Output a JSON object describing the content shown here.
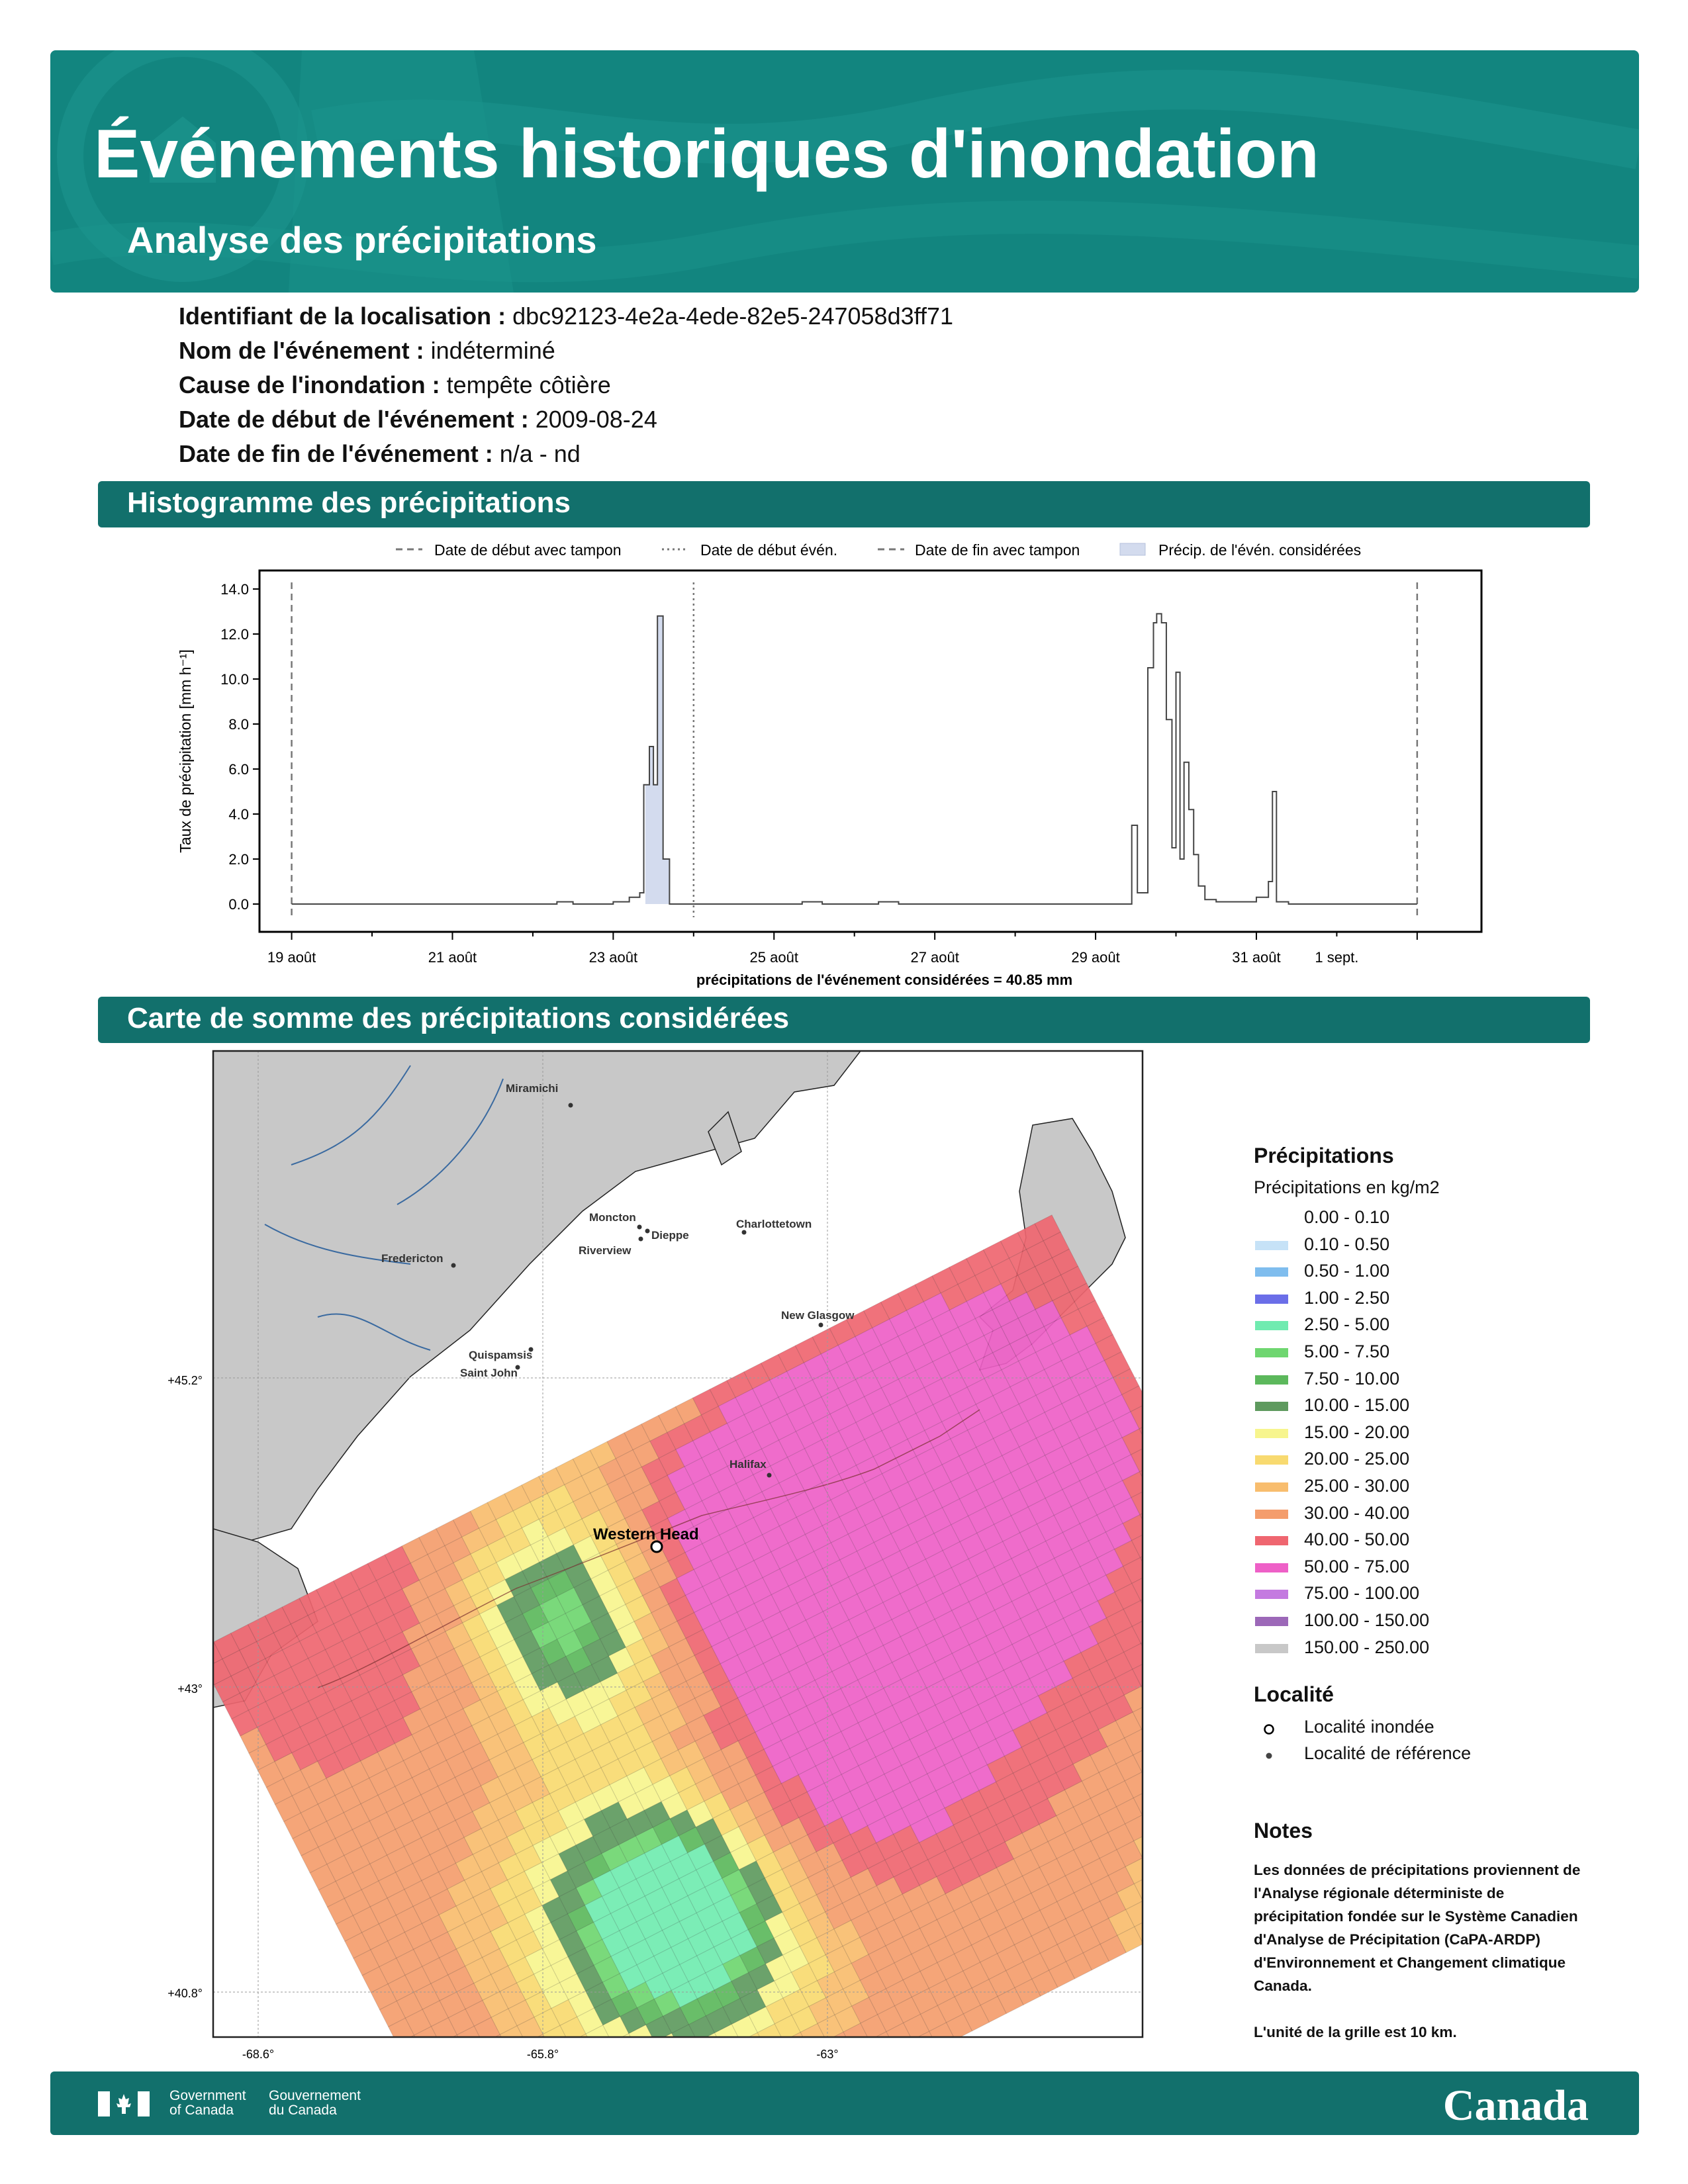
{
  "header": {
    "title": "Événements historiques d'inondation",
    "subtitle": "Analyse des précipitations"
  },
  "meta": [
    {
      "label": "Identifiant de la localisation :",
      "value": "dbc92123-4e2a-4ede-82e5-247058d3ff71"
    },
    {
      "label": "Nom de l'événement :",
      "value": "indéterminé"
    },
    {
      "label": "Cause de l'inondation :",
      "value": "tempête côtière"
    },
    {
      "label": "Date de début de l'événement :",
      "value": "2009-08-24"
    },
    {
      "label": "Date de fin de l'événement :",
      "value": "n/a - nd"
    }
  ],
  "sections": {
    "histogram": "Histogramme des précipitations",
    "map": "Carte de somme des précipitations considérées"
  },
  "chart_data": {
    "type": "line",
    "style": "step",
    "ylabel": "Taux de précipitation [mm h⁻¹]",
    "xlabel": "précipitations de l'événement considérées = 40.85 mm",
    "ylim": [
      0,
      14
    ],
    "yticks": [
      "0.0",
      "2.0",
      "4.0",
      "6.0",
      "8.0",
      "10.0",
      "12.0",
      "14.0"
    ],
    "xticks": [
      {
        "day": 19,
        "label": "19 août"
      },
      {
        "day": 21,
        "label": "21 août"
      },
      {
        "day": 23,
        "label": "23 août"
      },
      {
        "day": 25,
        "label": "25 août"
      },
      {
        "day": 27,
        "label": "27 août"
      },
      {
        "day": 29,
        "label": "29 août"
      },
      {
        "day": 31,
        "label": "31 août"
      },
      {
        "day": 32,
        "label": "1 sept."
      }
    ],
    "legend": {
      "placement": "top",
      "start_buffer": "Date de début avec tampon",
      "event_start": "Date de début évén.",
      "end_buffer": "Date de fin avec tampon",
      "considered": "Précip. de l'évén. considérées"
    },
    "markers": {
      "start_buffer": 19.0,
      "event_start": 24.0,
      "end_buffer": 33.0
    },
    "considered_range": [
      23.4,
      24.0
    ],
    "series": [
      {
        "values": [
          [
            19.0,
            0
          ],
          [
            22.3,
            0.1
          ],
          [
            22.5,
            0
          ],
          [
            23.0,
            0.1
          ],
          [
            23.2,
            0.3
          ],
          [
            23.33,
            0.5
          ],
          [
            23.38,
            5.3
          ],
          [
            23.45,
            7.0
          ],
          [
            23.5,
            5.3
          ],
          [
            23.55,
            12.8
          ],
          [
            23.62,
            2.0
          ],
          [
            23.7,
            0
          ],
          [
            24.3,
            0
          ],
          [
            25.35,
            0.1
          ],
          [
            25.6,
            0
          ],
          [
            26.3,
            0.1
          ],
          [
            26.55,
            0
          ],
          [
            29.45,
            3.5
          ],
          [
            29.52,
            0.5
          ],
          [
            29.65,
            10.5
          ],
          [
            29.72,
            12.5
          ],
          [
            29.76,
            12.9
          ],
          [
            29.82,
            12.5
          ],
          [
            29.88,
            8.2
          ],
          [
            29.95,
            2.5
          ],
          [
            30.0,
            10.3
          ],
          [
            30.05,
            2.0
          ],
          [
            30.1,
            6.3
          ],
          [
            30.16,
            4.2
          ],
          [
            30.22,
            2.2
          ],
          [
            30.28,
            0.8
          ],
          [
            30.36,
            0.2
          ],
          [
            30.5,
            0.1
          ],
          [
            31.0,
            0.3
          ],
          [
            31.15,
            1.0
          ],
          [
            31.2,
            5.0
          ],
          [
            31.25,
            0.1
          ],
          [
            31.4,
            0
          ],
          [
            33.0,
            0
          ]
        ]
      }
    ]
  },
  "map": {
    "cities": [
      {
        "name": "Miramichi",
        "kind": "reference"
      },
      {
        "name": "Moncton",
        "kind": "reference"
      },
      {
        "name": "Dieppe",
        "kind": "reference"
      },
      {
        "name": "Riverview",
        "kind": "reference"
      },
      {
        "name": "Charlottetown",
        "kind": "reference"
      },
      {
        "name": "Fredericton",
        "kind": "reference"
      },
      {
        "name": "New Glasgow",
        "kind": "reference"
      },
      {
        "name": "Quispamsis",
        "kind": "reference"
      },
      {
        "name": "Saint John",
        "kind": "reference"
      },
      {
        "name": "Halifax",
        "kind": "reference"
      },
      {
        "name": "Western Head",
        "kind": "flooded"
      }
    ],
    "lat_labels": [
      "+45.2°",
      "+43°",
      "+40.8°"
    ],
    "lon_labels": [
      "-68.6°",
      "-65.8°",
      "-63°"
    ]
  },
  "legend": {
    "title": "Précipitations",
    "subtitle": "Précipitations en kg/m2",
    "items": [
      {
        "label": "0.00 - 0.10",
        "color": "#ffffff"
      },
      {
        "label": "0.10 - 0.50",
        "color": "#c6e2f7"
      },
      {
        "label": "0.50 - 1.00",
        "color": "#7fbdee"
      },
      {
        "label": "1.00 - 2.50",
        "color": "#6b6ee8"
      },
      {
        "label": "2.50 - 5.00",
        "color": "#70ebb0"
      },
      {
        "label": "5.00 - 7.50",
        "color": "#6fd670"
      },
      {
        "label": "7.50 - 10.00",
        "color": "#5cb85c"
      },
      {
        "label": "10.00 - 15.00",
        "color": "#5e9a5e"
      },
      {
        "label": "15.00 - 20.00",
        "color": "#f7f58e"
      },
      {
        "label": "20.00 - 25.00",
        "color": "#f8da70"
      },
      {
        "label": "25.00 - 30.00",
        "color": "#f8bd6e"
      },
      {
        "label": "30.00 - 40.00",
        "color": "#f49d6c"
      },
      {
        "label": "40.00 - 50.00",
        "color": "#ef6670"
      },
      {
        "label": "50.00 - 75.00",
        "color": "#ee60c7"
      },
      {
        "label": "75.00 - 100.00",
        "color": "#c47ae0"
      },
      {
        "label": "100.00 - 150.00",
        "color": "#9c68b8"
      },
      {
        "label": "150.00 - 250.00",
        "color": "#c8c8c8"
      }
    ],
    "locality_title": "Localité",
    "flooded": "Localité inondée",
    "reference": "Localité de référence"
  },
  "notes": {
    "title": "Notes",
    "text": "Les données de précipitations proviennent de l'Analyse régionale déterministe de précipitation fondée sur le Système Canadien d'Analyse de Précipitation (CaPA-ARDP) d'Environnement et Changement climatique Canada.",
    "grid": "L'unité de la grille est 10 km."
  },
  "footer": {
    "gov_en_1": "Government",
    "gov_en_2": "of Canada",
    "gov_fr_1": "Gouvernement",
    "gov_fr_2": "du Canada",
    "wordmark": "Canada"
  }
}
